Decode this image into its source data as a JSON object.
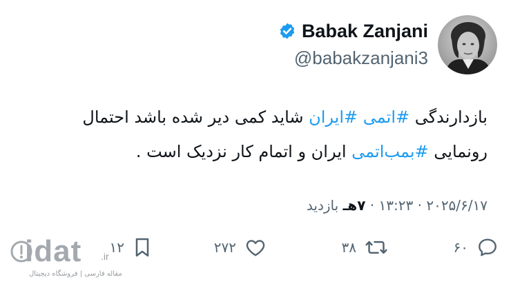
{
  "author": {
    "name": "Babak Zanjani",
    "handle": "@babakzanjani3",
    "verified": true,
    "avatar_icon": "portrait-photo"
  },
  "tweet": {
    "line1": {
      "t1": "بازدارندگی ",
      "h1": "#اتمی",
      "t2": " ",
      "h2": "#ایران",
      "t3": " شاید کمی دیر شده باشد احتمال"
    },
    "line2": {
      "t1": "رونمایی ",
      "h1": "#بمب‌اتمی",
      "t2": " ایران و اتمام کار نزدیک است ."
    }
  },
  "meta": {
    "time": "۱۳:۲۳",
    "date": "۲۰۲۵/۶/۱۷",
    "separator": " · ",
    "views_count": "۷هـ",
    "views_label": " بازدید"
  },
  "actions": {
    "replies": "۶۰",
    "retweets": "۳۸",
    "likes": "۲۷۲",
    "bookmarks": "۱۲"
  },
  "watermark": {
    "text": "idat",
    "tld": ".ir",
    "subtitle": "مقاله فارسی | فروشگاه دیجیتال"
  },
  "colors": {
    "hashtag": "#1d9bf0",
    "verified": "#1d9bf0",
    "secondary_text": "#536471",
    "primary_text": "#0f1419"
  }
}
